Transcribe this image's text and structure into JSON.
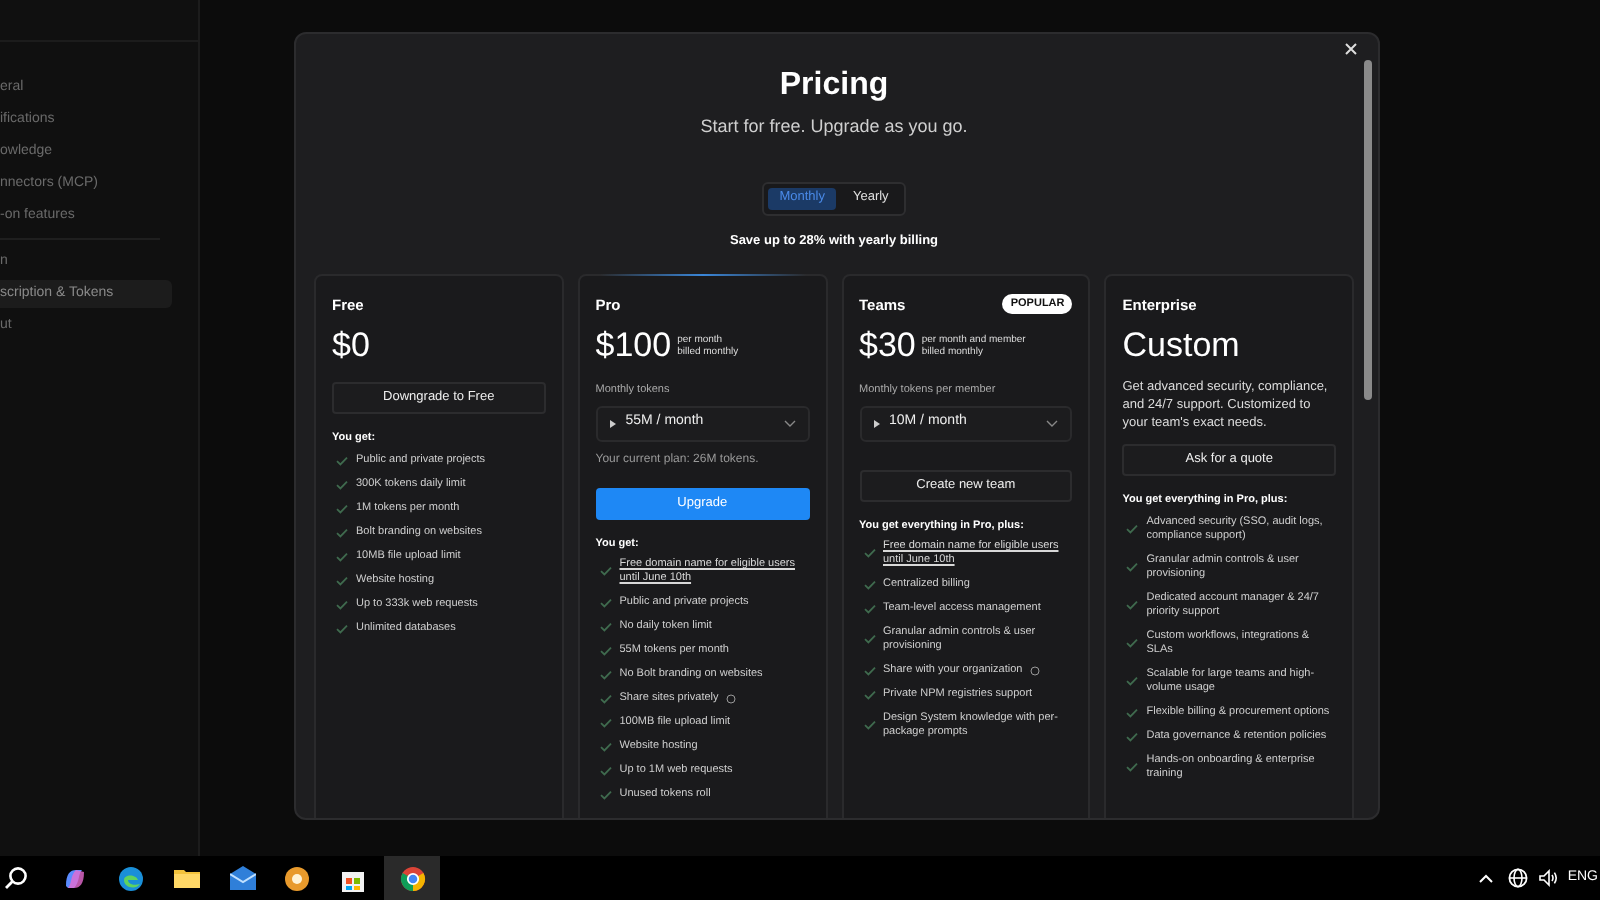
{
  "sidebar": {
    "items": [
      {
        "label": "eral",
        "selected": false
      },
      {
        "label": "ifications",
        "selected": false
      },
      {
        "label": "owledge",
        "selected": false
      },
      {
        "label": "nnectors (MCP)",
        "selected": false
      },
      {
        "label": "-on features",
        "selected": false,
        "divider_after": true
      },
      {
        "label": "n",
        "selected": false
      },
      {
        "label": "scription & Tokens",
        "selected": true
      },
      {
        "label": "ut",
        "selected": false
      }
    ]
  },
  "modal": {
    "title": "Pricing",
    "subtitle": "Start for free. Upgrade as you go.",
    "billing_toggle": [
      {
        "label": "Monthly",
        "selected": true
      },
      {
        "label": "Yearly",
        "selected": false
      }
    ],
    "save_note": "Save up to 28% with yearly billing",
    "plans": [
      {
        "name": "Free",
        "highlighted": false,
        "price": "$0",
        "button": {
          "label": "Downgrade to Free",
          "kind": "secondary"
        },
        "features_heading": "You get:",
        "features": [
          {
            "text": "Public and private projects",
            "kind": "plain",
            "info": false
          },
          {
            "text": "300K tokens daily limit",
            "kind": "plain",
            "info": false
          },
          {
            "text": "1M tokens per month",
            "kind": "plain",
            "info": false
          },
          {
            "text": "Bolt branding on websites",
            "kind": "plain",
            "info": false
          },
          {
            "text": "10MB file upload limit",
            "kind": "plain",
            "info": false
          },
          {
            "text": "Website hosting",
            "kind": "plain",
            "info": false
          },
          {
            "text": "Up to 333k web requests",
            "kind": "plain",
            "info": false
          },
          {
            "text": "Unlimited databases",
            "kind": "plain",
            "info": false
          }
        ]
      },
      {
        "name": "Pro",
        "highlighted": true,
        "price": "$100",
        "price_note": [
          "per month",
          "billed monthly"
        ],
        "token_label": "Monthly tokens",
        "token_select": "55M / month",
        "current_plan_note": "Your current plan: 26M tokens.",
        "button": {
          "label": "Upgrade",
          "kind": "primary"
        },
        "features_heading": "You get:",
        "features": [
          {
            "text": "Free domain name for eligible users until June 10th",
            "kind": "link",
            "info": false
          },
          {
            "text": "Public and private projects",
            "kind": "plain",
            "info": false
          },
          {
            "text": "No daily token limit",
            "kind": "plain",
            "info": false
          },
          {
            "text": "55M tokens per month",
            "kind": "plain",
            "info": false
          },
          {
            "text": "No Bolt branding on websites",
            "kind": "plain",
            "info": false
          },
          {
            "text": "Share sites privately",
            "kind": "plain",
            "info": true
          },
          {
            "text": "100MB file upload limit",
            "kind": "plain",
            "info": false
          },
          {
            "text": "Website hosting",
            "kind": "plain",
            "info": false
          },
          {
            "text": "Up to 1M web requests",
            "kind": "plain",
            "info": false
          },
          {
            "text": "Unused tokens roll",
            "kind": "plain",
            "info": false
          }
        ]
      },
      {
        "name": "Teams",
        "highlighted": false,
        "badge": "POPULAR",
        "price": "$30",
        "price_note": [
          "per month and member",
          "billed monthly"
        ],
        "token_label": "Monthly tokens per member",
        "token_select": "10M / month",
        "button": {
          "label": "Create new team",
          "kind": "secondary"
        },
        "features_heading": "You get everything in Pro, plus:",
        "features": [
          {
            "text": "Free domain name for eligible users until June 10th",
            "kind": "link",
            "info": false
          },
          {
            "text": "Centralized billing",
            "kind": "plain",
            "info": false
          },
          {
            "text": "Team-level access management",
            "kind": "plain",
            "info": false
          },
          {
            "text": "Granular admin controls & user provisioning",
            "kind": "plain",
            "info": false
          },
          {
            "text": "Share with your organization",
            "kind": "plain",
            "info": true
          },
          {
            "text": "Private NPM registries support",
            "kind": "plain",
            "info": false
          },
          {
            "text": "Design System knowledge with per-package prompts",
            "kind": "plain",
            "info": false
          }
        ]
      },
      {
        "name": "Enterprise",
        "highlighted": false,
        "price": "Custom",
        "description": "Get advanced security, compliance, and 24/7 support. Customized to your team's exact needs.",
        "button": {
          "label": "Ask for a quote",
          "kind": "secondary"
        },
        "features_heading": "You get everything in Pro, plus:",
        "features": [
          {
            "text": "Advanced security (SSO, audit logs, compliance support)",
            "kind": "plain",
            "info": false
          },
          {
            "text": "Granular admin controls & user provisioning",
            "kind": "plain",
            "info": false
          },
          {
            "text": "Dedicated account manager & 24/7 priority support",
            "kind": "plain",
            "info": false
          },
          {
            "text": "Custom workflows, integrations & SLAs",
            "kind": "plain",
            "info": false
          },
          {
            "text": "Scalable for large teams and high-volume usage",
            "kind": "plain",
            "info": false
          },
          {
            "text": "Flexible billing & procurement options",
            "kind": "plain",
            "info": false
          },
          {
            "text": "Data governance & retention policies",
            "kind": "plain",
            "info": false
          },
          {
            "text": "Hands-on onboarding & enterprise training",
            "kind": "plain",
            "info": false
          }
        ]
      }
    ]
  },
  "taskbar": {
    "language": "ENG"
  }
}
